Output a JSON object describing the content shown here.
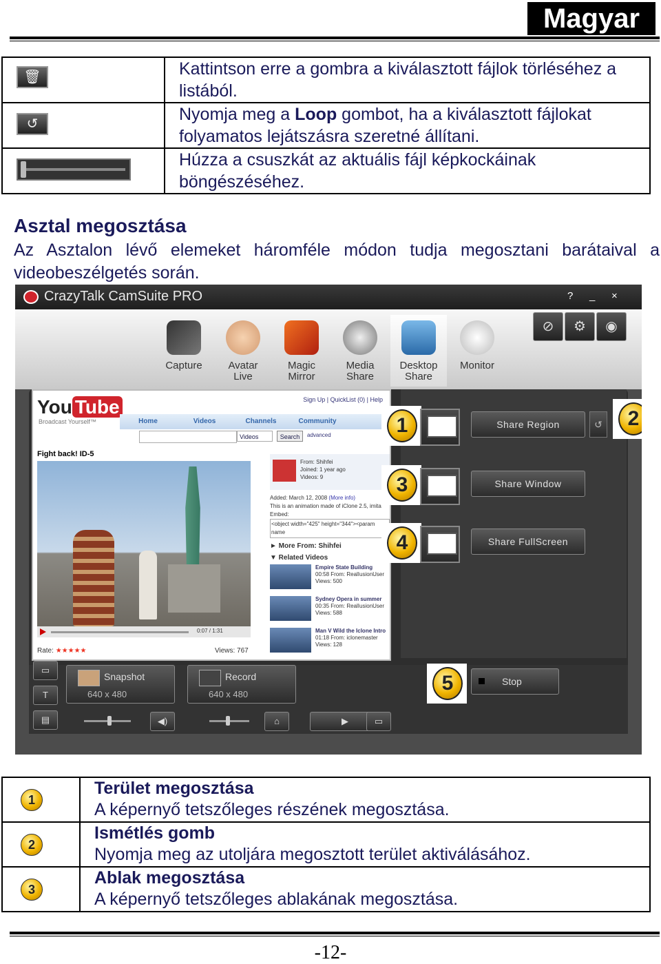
{
  "header": {
    "language": "Magyar"
  },
  "table1": [
    {
      "icon": "trash-icon",
      "text": "Kattintson erre a gombra a kiválasztott fájlok törléséhez a listából."
    },
    {
      "icon": "loop-icon",
      "text_before": "Nyomja meg a ",
      "text_bold": "Loop",
      "text_after": " gombot, ha a kiválasztott fájlokat folyamatos lejátszásra szeretné állítani."
    },
    {
      "icon": "slider-icon",
      "text": "Húzza a csuszkát az aktuális fájl képkockáinak böngészéséhez."
    }
  ],
  "section": {
    "title": "Asztal megosztása",
    "intro": "Az Asztalon lévő elemeket háromféle módon tudja megosztani barátaival a videobeszélgetés során."
  },
  "app": {
    "title": "CrazyTalk CamSuite PRO",
    "window_controls": [
      "?",
      "_",
      "×"
    ],
    "tools": [
      {
        "line1": "Capture",
        "line2": ""
      },
      {
        "line1": "Avatar",
        "line2": "Live"
      },
      {
        "line1": "Magic",
        "line2": "Mirror"
      },
      {
        "line1": "Media",
        "line2": "Share"
      },
      {
        "line1": "Desktop",
        "line2": "Share"
      },
      {
        "line1": "Monitor",
        "line2": ""
      }
    ],
    "share_buttons": {
      "region": "Share Region",
      "window": "Share Window",
      "fullscreen": "Share FullScreen",
      "stop": "Stop"
    },
    "markers": [
      "1",
      "2",
      "3",
      "4",
      "5"
    ],
    "snapshot": {
      "label": "Snapshot",
      "resolution": "640 x 480"
    },
    "record": {
      "label": "Record",
      "resolution": "640 x 480"
    },
    "web": {
      "logo_you": "You",
      "logo_tube": "Tube",
      "tagline": "Broadcast Yourself™",
      "top_links": "Sign Up | QuickList (0) | Help",
      "nav": [
        "Home",
        "Videos",
        "Channels",
        "Community"
      ],
      "search_select": "Videos",
      "search_button": "Search",
      "advanced": "advanced",
      "video_title": "Fight back! ID-5",
      "time": "0:07 / 1:31",
      "rate_label": "Rate:",
      "stars": "★★★★★",
      "views": "Views: 767",
      "from": "From: Shihfei",
      "joined": "Joined: 1 year ago",
      "videos": "Videos: 9",
      "added": "Added: March 12, 2008",
      "more_info": "(More info)",
      "desc": "This is an animation made of iClone 2.5, imita",
      "embed": "Embed:",
      "embed_code": "<object width=\"425\" height=\"344\"><param name",
      "more_from": "► More From: Shihfei",
      "related": "▼ Related Videos",
      "related_items": [
        {
          "title": "Empire State Building",
          "time": "00:58 From: RealIusionUser",
          "views": "Views: 500"
        },
        {
          "title": "Sydney Opera in summer",
          "time": "00:35 From: RealIusionUser",
          "views": "Views: 588"
        },
        {
          "title": "Man V Wild the Iclone Intro",
          "time": "01:18 From: iclonemaster",
          "views": "Views: 128"
        }
      ]
    }
  },
  "table2": [
    {
      "marker": "1",
      "title": "Terület megosztása",
      "desc": "A képernyő tetszőleges részének megosztása."
    },
    {
      "marker": "2",
      "title": "Ismétlés gomb",
      "desc": "Nyomja meg az utoljára megosztott terület aktiválásához."
    },
    {
      "marker": "3",
      "title": "Ablak megosztása",
      "desc": "A képernyő tetszőleges ablakának megosztása."
    }
  ],
  "footer": {
    "page": "-12-"
  }
}
